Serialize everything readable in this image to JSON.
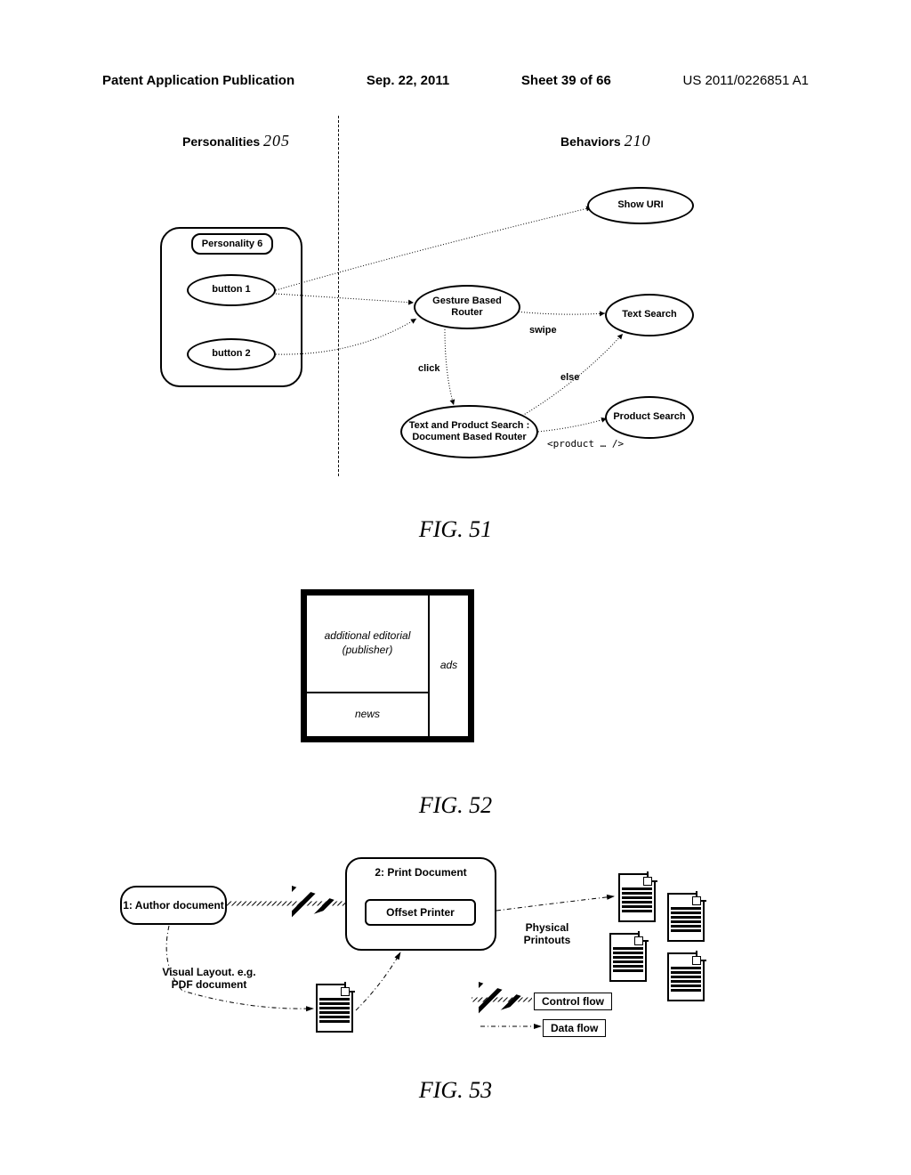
{
  "header": {
    "left": "Patent Application Publication",
    "date": "Sep. 22, 2011",
    "sheet": "Sheet 39 of 66",
    "pubno": "US 2011/0226851 A1"
  },
  "fig51": {
    "personalities_label": "Personalities",
    "personalities_num": "205",
    "behaviors_label": "Behaviors",
    "behaviors_num": "210",
    "personality6": "Personality 6",
    "button1": "button 1",
    "button2": "button 2",
    "show_uri": "Show URI",
    "gesture_router": "Gesture Based Router",
    "text_search": "Text Search",
    "doc_router": "Text and Product Search : Document Based Router",
    "product_search": "Product Search",
    "edge_click": "click",
    "edge_swipe": "swipe",
    "edge_else": "else",
    "edge_product": "<product … />",
    "caption": "FIG. 51"
  },
  "fig52": {
    "editorial": "additional editorial (publisher)",
    "news": "news",
    "ads": "ads",
    "caption": "FIG. 52"
  },
  "fig53": {
    "author": "1: Author document",
    "print_doc": "2: Print Document",
    "offset": "Offset Printer",
    "visual_layout": "Visual Layout. e.g. PDF document",
    "physical": "Physical Printouts",
    "control_flow": "Control flow",
    "data_flow": "Data flow",
    "caption": "FIG. 53"
  }
}
